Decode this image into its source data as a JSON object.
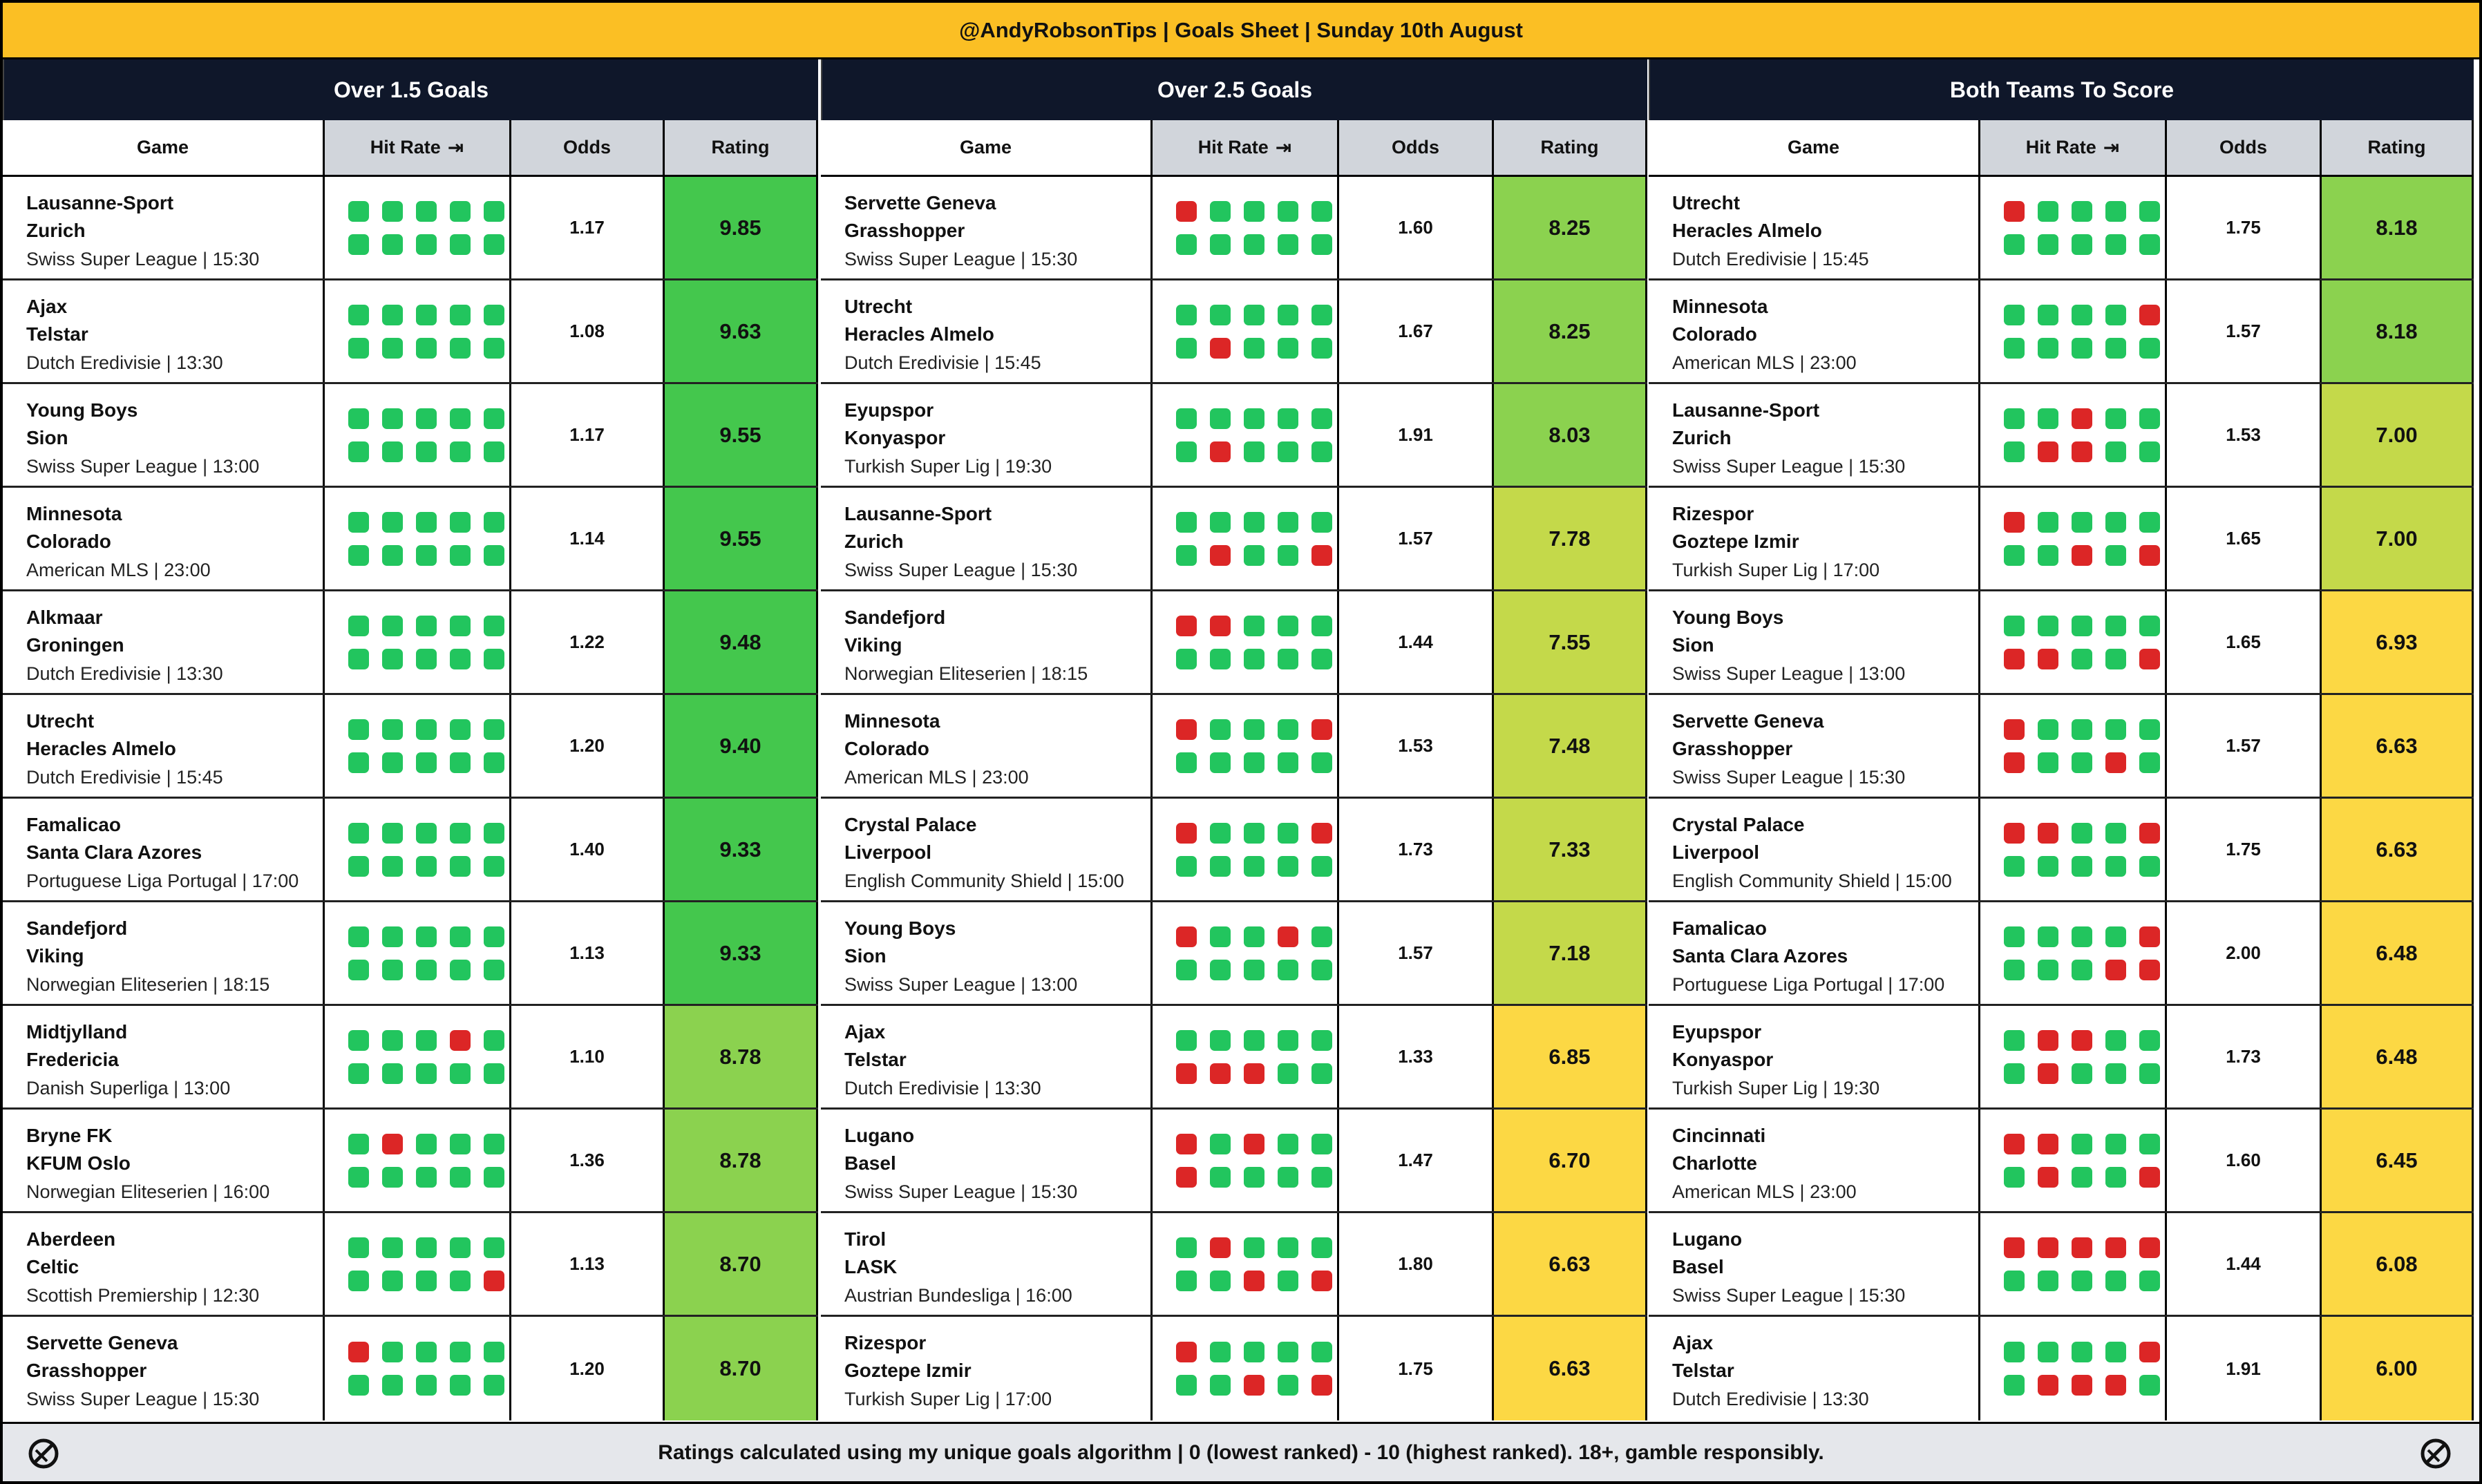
{
  "title": "@AndyRobsonTips | Goals Sheet | Sunday 10th August",
  "columns": {
    "game": "Game",
    "hit_rate": "Hit Rate",
    "hit_rate_icon": "arrow-right-to-bar-icon",
    "odds": "Odds",
    "rating": "Rating"
  },
  "colors": {
    "great": "#44c74d",
    "good": "#8bd24f",
    "mid": "#c4d94a",
    "ok": "#fcd844",
    "hit": "#22c55e",
    "miss": "#dc2626"
  },
  "footer": "Ratings calculated using my unique goals algorithm | 0 (lowest ranked) - 10 (highest ranked). 18+, gamble responsibly.",
  "panels": [
    {
      "title": "Over 1.5 Goals",
      "rows": [
        {
          "home": "Lausanne-Sport",
          "away": "Zurich",
          "meta": "Swiss Super League | 15:30",
          "hits": [
            "ggggg",
            "ggggg"
          ],
          "odds": "1.17",
          "rating": "9.85",
          "tier": "great"
        },
        {
          "home": "Ajax",
          "away": "Telstar",
          "meta": "Dutch Eredivisie | 13:30",
          "hits": [
            "ggggg",
            "ggggg"
          ],
          "odds": "1.08",
          "rating": "9.63",
          "tier": "great"
        },
        {
          "home": "Young Boys",
          "away": "Sion",
          "meta": "Swiss Super League | 13:00",
          "hits": [
            "ggggg",
            "ggggg"
          ],
          "odds": "1.17",
          "rating": "9.55",
          "tier": "great"
        },
        {
          "home": "Minnesota",
          "away": "Colorado",
          "meta": "American MLS | 23:00",
          "hits": [
            "ggggg",
            "ggggg"
          ],
          "odds": "1.14",
          "rating": "9.55",
          "tier": "great"
        },
        {
          "home": "Alkmaar",
          "away": "Groningen",
          "meta": "Dutch Eredivisie | 13:30",
          "hits": [
            "ggggg",
            "ggggg"
          ],
          "odds": "1.22",
          "rating": "9.48",
          "tier": "great"
        },
        {
          "home": "Utrecht",
          "away": "Heracles Almelo",
          "meta": "Dutch Eredivisie | 15:45",
          "hits": [
            "ggggg",
            "ggggg"
          ],
          "odds": "1.20",
          "rating": "9.40",
          "tier": "great"
        },
        {
          "home": "Famalicao",
          "away": "Santa Clara Azores",
          "meta": "Portuguese Liga Portugal | 17:00",
          "hits": [
            "ggggg",
            "ggggg"
          ],
          "odds": "1.40",
          "rating": "9.33",
          "tier": "great"
        },
        {
          "home": "Sandefjord",
          "away": "Viking",
          "meta": "Norwegian Eliteserien | 18:15",
          "hits": [
            "ggggg",
            "ggggg"
          ],
          "odds": "1.13",
          "rating": "9.33",
          "tier": "great"
        },
        {
          "home": "Midtjylland",
          "away": "Fredericia",
          "meta": "Danish Superliga | 13:00",
          "hits": [
            "gggrg",
            "ggggg"
          ],
          "odds": "1.10",
          "rating": "8.78",
          "tier": "good"
        },
        {
          "home": "Bryne FK",
          "away": "KFUM Oslo",
          "meta": "Norwegian Eliteserien | 16:00",
          "hits": [
            "grggg",
            "ggggg"
          ],
          "odds": "1.36",
          "rating": "8.78",
          "tier": "good"
        },
        {
          "home": "Aberdeen",
          "away": "Celtic",
          "meta": "Scottish Premiership | 12:30",
          "hits": [
            "ggggg",
            "ggggr"
          ],
          "odds": "1.13",
          "rating": "8.70",
          "tier": "good"
        },
        {
          "home": "Servette Geneva",
          "away": "Grasshopper",
          "meta": "Swiss Super League | 15:30",
          "hits": [
            "rgggg",
            "ggggg"
          ],
          "odds": "1.20",
          "rating": "8.70",
          "tier": "good"
        }
      ]
    },
    {
      "title": "Over 2.5 Goals",
      "rows": [
        {
          "home": "Servette Geneva",
          "away": "Grasshopper",
          "meta": "Swiss Super League | 15:30",
          "hits": [
            "rgggg",
            "ggggg"
          ],
          "odds": "1.60",
          "rating": "8.25",
          "tier": "good"
        },
        {
          "home": "Utrecht",
          "away": "Heracles Almelo",
          "meta": "Dutch Eredivisie | 15:45",
          "hits": [
            "ggggg",
            "grggg"
          ],
          "odds": "1.67",
          "rating": "8.25",
          "tier": "good"
        },
        {
          "home": "Eyupspor",
          "away": "Konyaspor",
          "meta": "Turkish Super Lig | 19:30",
          "hits": [
            "ggggg",
            "grggg"
          ],
          "odds": "1.91",
          "rating": "8.03",
          "tier": "good"
        },
        {
          "home": "Lausanne-Sport",
          "away": "Zurich",
          "meta": "Swiss Super League | 15:30",
          "hits": [
            "ggggg",
            "grggr"
          ],
          "odds": "1.57",
          "rating": "7.78",
          "tier": "mid"
        },
        {
          "home": "Sandefjord",
          "away": "Viking",
          "meta": "Norwegian Eliteserien | 18:15",
          "hits": [
            "rrggg",
            "ggggg"
          ],
          "odds": "1.44",
          "rating": "7.55",
          "tier": "mid"
        },
        {
          "home": "Minnesota",
          "away": "Colorado",
          "meta": "American MLS | 23:00",
          "hits": [
            "rgggr",
            "ggggg"
          ],
          "odds": "1.53",
          "rating": "7.48",
          "tier": "mid"
        },
        {
          "home": "Crystal Palace",
          "away": "Liverpool",
          "meta": "English Community Shield | 15:00",
          "hits": [
            "rgggr",
            "ggggg"
          ],
          "odds": "1.73",
          "rating": "7.33",
          "tier": "mid"
        },
        {
          "home": "Young Boys",
          "away": "Sion",
          "meta": "Swiss Super League | 13:00",
          "hits": [
            "rggrg",
            "ggggg"
          ],
          "odds": "1.57",
          "rating": "7.18",
          "tier": "mid"
        },
        {
          "home": "Ajax",
          "away": "Telstar",
          "meta": "Dutch Eredivisie | 13:30",
          "hits": [
            "ggggg",
            "rrrgg"
          ],
          "odds": "1.33",
          "rating": "6.85",
          "tier": "ok"
        },
        {
          "home": "Lugano",
          "away": "Basel",
          "meta": "Swiss Super League | 15:30",
          "hits": [
            "rgrgg",
            "rgggg"
          ],
          "odds": "1.47",
          "rating": "6.70",
          "tier": "ok"
        },
        {
          "home": "Tirol",
          "away": "LASK",
          "meta": "Austrian Bundesliga | 16:00",
          "hits": [
            "grggg",
            "ggrgr"
          ],
          "odds": "1.80",
          "rating": "6.63",
          "tier": "ok"
        },
        {
          "home": "Rizespor",
          "away": "Goztepe Izmir",
          "meta": "Turkish Super Lig | 17:00",
          "hits": [
            "rgggg",
            "ggrgr"
          ],
          "odds": "1.75",
          "rating": "6.63",
          "tier": "ok"
        }
      ]
    },
    {
      "title": "Both Teams To Score",
      "rows": [
        {
          "home": "Utrecht",
          "away": "Heracles Almelo",
          "meta": "Dutch Eredivisie | 15:45",
          "hits": [
            "rgggg",
            "ggggg"
          ],
          "odds": "1.75",
          "rating": "8.18",
          "tier": "good"
        },
        {
          "home": "Minnesota",
          "away": "Colorado",
          "meta": "American MLS | 23:00",
          "hits": [
            "ggggr",
            "ggggg"
          ],
          "odds": "1.57",
          "rating": "8.18",
          "tier": "good"
        },
        {
          "home": "Lausanne-Sport",
          "away": "Zurich",
          "meta": "Swiss Super League | 15:30",
          "hits": [
            "ggrgg",
            "grrgg"
          ],
          "odds": "1.53",
          "rating": "7.00",
          "tier": "mid"
        },
        {
          "home": "Rizespor",
          "away": "Goztepe Izmir",
          "meta": "Turkish Super Lig | 17:00",
          "hits": [
            "rgggg",
            "ggrgr"
          ],
          "odds": "1.65",
          "rating": "7.00",
          "tier": "mid"
        },
        {
          "home": "Young Boys",
          "away": "Sion",
          "meta": "Swiss Super League | 13:00",
          "hits": [
            "ggggg",
            "rrggr"
          ],
          "odds": "1.65",
          "rating": "6.93",
          "tier": "ok"
        },
        {
          "home": "Servette Geneva",
          "away": "Grasshopper",
          "meta": "Swiss Super League | 15:30",
          "hits": [
            "rgggg",
            "rggrg"
          ],
          "odds": "1.57",
          "rating": "6.63",
          "tier": "ok"
        },
        {
          "home": "Crystal Palace",
          "away": "Liverpool",
          "meta": "English Community Shield | 15:00",
          "hits": [
            "rrggr",
            "ggggg"
          ],
          "odds": "1.75",
          "rating": "6.63",
          "tier": "ok"
        },
        {
          "home": "Famalicao",
          "away": "Santa Clara Azores",
          "meta": "Portuguese Liga Portugal | 17:00",
          "hits": [
            "ggggr",
            "gggrr"
          ],
          "odds": "2.00",
          "rating": "6.48",
          "tier": "ok"
        },
        {
          "home": "Eyupspor",
          "away": "Konyaspor",
          "meta": "Turkish Super Lig | 19:30",
          "hits": [
            "grrgg",
            "grggg"
          ],
          "odds": "1.73",
          "rating": "6.48",
          "tier": "ok"
        },
        {
          "home": "Cincinnati",
          "away": "Charlotte",
          "meta": "American MLS | 23:00",
          "hits": [
            "rrggg",
            "grggr"
          ],
          "odds": "1.60",
          "rating": "6.45",
          "tier": "ok"
        },
        {
          "home": "Lugano",
          "away": "Basel",
          "meta": "Swiss Super League | 15:30",
          "hits": [
            "rrrrr",
            "ggggg"
          ],
          "odds": "1.44",
          "rating": "6.08",
          "tier": "ok"
        },
        {
          "home": "Ajax",
          "away": "Telstar",
          "meta": "Dutch Eredivisie | 13:30",
          "hits": [
            "ggggr",
            "grrrg"
          ],
          "odds": "1.91",
          "rating": "6.00",
          "tier": "ok"
        }
      ]
    }
  ]
}
